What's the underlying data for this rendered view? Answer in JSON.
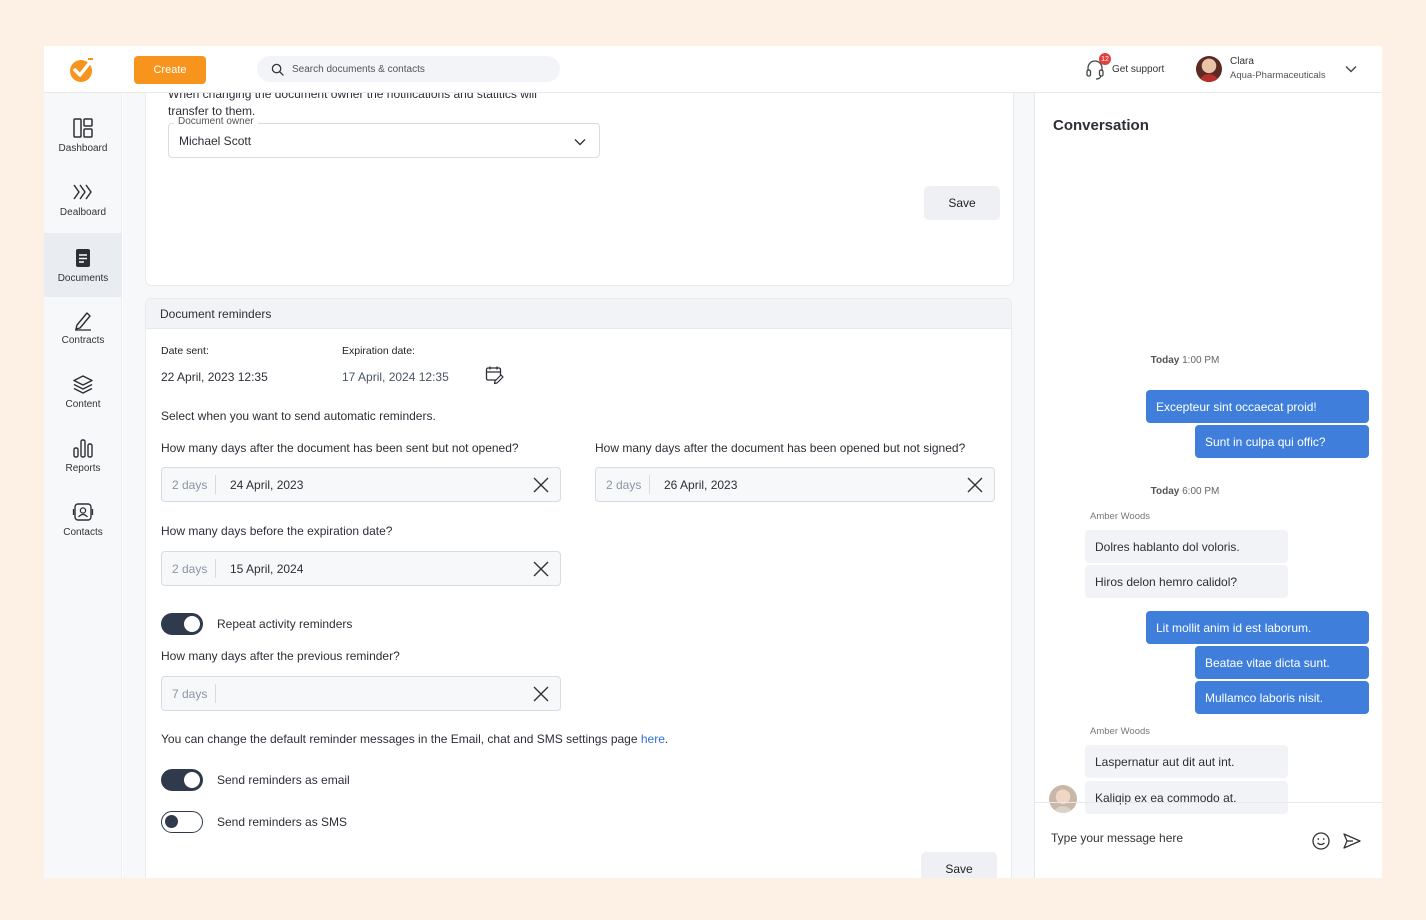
{
  "topbar": {
    "create_label": "Create",
    "search_placeholder": "Search documents & contacts",
    "support_label": "Get support",
    "support_badge": "12",
    "user_name": "Clara",
    "user_org": "Aqua-Pharmaceuticals"
  },
  "sidebar": {
    "items": [
      {
        "label": "Dashboard"
      },
      {
        "label": "Dealboard"
      },
      {
        "label": "Documents"
      },
      {
        "label": "Contracts"
      },
      {
        "label": "Content"
      },
      {
        "label": "Reports"
      },
      {
        "label": "Contacts"
      }
    ]
  },
  "owner": {
    "note": "When changing the document owner the notifications and statitics will transfer to them.",
    "field_label": "Document owner",
    "value": "Michael Scott",
    "save_label": "Save"
  },
  "reminders": {
    "title": "Document reminders",
    "date_sent_label": "Date sent:",
    "date_sent": "22 April, 2023 12:35",
    "expiration_label": "Expiration date:",
    "expiration": "17 April, 2024 12:35",
    "intro": "Select when you want to send automatic reminders.",
    "q_not_opened": "How many days after the document has been sent but not opened?",
    "q_not_signed": "How many days after the document has been opened but not signed?",
    "q_before_expiration": "How many days before the expiration date?",
    "not_opened": {
      "days": "2 days",
      "date": "24 April, 2023"
    },
    "not_signed": {
      "days": "2 days",
      "date": "26 April, 2023"
    },
    "before_expiration": {
      "days": "2 days",
      "date": "15 April, 2024"
    },
    "repeat_label": "Repeat activity reminders",
    "repeat_on": true,
    "q_previous": "How many days after the previous reminder?",
    "previous": {
      "days": "7 days",
      "date": ""
    },
    "settings_text": "You can change the default reminder messages in the Email, chat and SMS settings page ",
    "settings_link": "here",
    "settings_end": ".",
    "email_label": "Send reminders as email",
    "email_on": true,
    "sms_label": "Send reminders as SMS",
    "sms_on": false,
    "save_label": "Save"
  },
  "conversation": {
    "title": "Conversation",
    "groups": [
      {
        "day": "Today",
        "time": "1:00 PM"
      },
      {
        "day": "Today",
        "time": "6:00 PM"
      }
    ],
    "sender": "Amber Woods",
    "messages": [
      "Excepteur sint occaecat proid!",
      "Sunt in culpa qui offic?",
      "Dolres hablanto dol voloris.",
      "Hiros delon hemro calidol?",
      "Lit mollit anim id est laborum.",
      "Beatae vitae dicta sunt.",
      "Mullamco laboris nisit.",
      "Laspernatur aut dit aut int.",
      "Kaliqip ex ea commodo at."
    ],
    "input_placeholder": "Type your message here"
  },
  "colors": {
    "accent": "#f7941d",
    "outgoing_bubble": "#3f7fdb",
    "toggle": "#2f3b4d",
    "link": "#2f6fd6"
  },
  "icons": {
    "logo": "check-circle-logo-icon",
    "search": "search-icon",
    "support": "headset-icon",
    "dropdown": "chevron-down-icon",
    "calendar_edit": "calendar-edit-icon",
    "clear": "close-icon",
    "emoji": "smiley-icon",
    "send": "send-icon"
  }
}
